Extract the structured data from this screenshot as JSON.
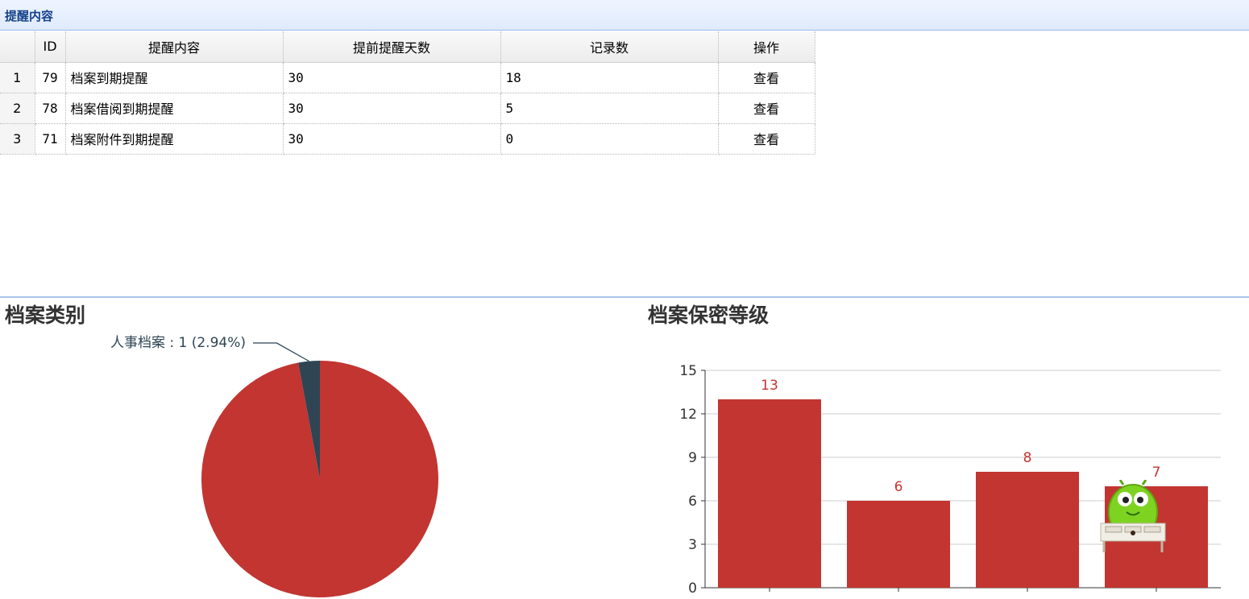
{
  "panel": {
    "title": "提醒内容"
  },
  "grid": {
    "columns": [
      "ID",
      "提醒内容",
      "提前提醒天数",
      "记录数",
      "操作"
    ],
    "rows": [
      {
        "rownum": "1",
        "id": "79",
        "content": "档案到期提醒",
        "days": "30",
        "count": "18",
        "action": "查看"
      },
      {
        "rownum": "2",
        "id": "78",
        "content": "档案借阅到期提醒",
        "days": "30",
        "count": "5",
        "action": "查看"
      },
      {
        "rownum": "3",
        "id": "71",
        "content": "档案附件到期提醒",
        "days": "30",
        "count": "0",
        "action": "查看"
      }
    ]
  },
  "chart_data": [
    {
      "type": "pie",
      "title": "档案类别",
      "slices": [
        {
          "name": "人事档案",
          "value": 1,
          "percent": "2.94%",
          "label": "人事档案 : 1 (2.94%)",
          "color": "#2f4554"
        },
        {
          "name": "",
          "value": 33,
          "color": "#c23531"
        }
      ]
    },
    {
      "type": "bar",
      "title": "档案保密等级",
      "categories": [
        "",
        "",
        "",
        ""
      ],
      "values": [
        13,
        6,
        8,
        7
      ],
      "ylim": [
        0,
        15
      ],
      "yticks": [
        "0",
        "3",
        "6",
        "9",
        "12",
        "15"
      ],
      "grid": true,
      "color": "#c23531"
    }
  ]
}
